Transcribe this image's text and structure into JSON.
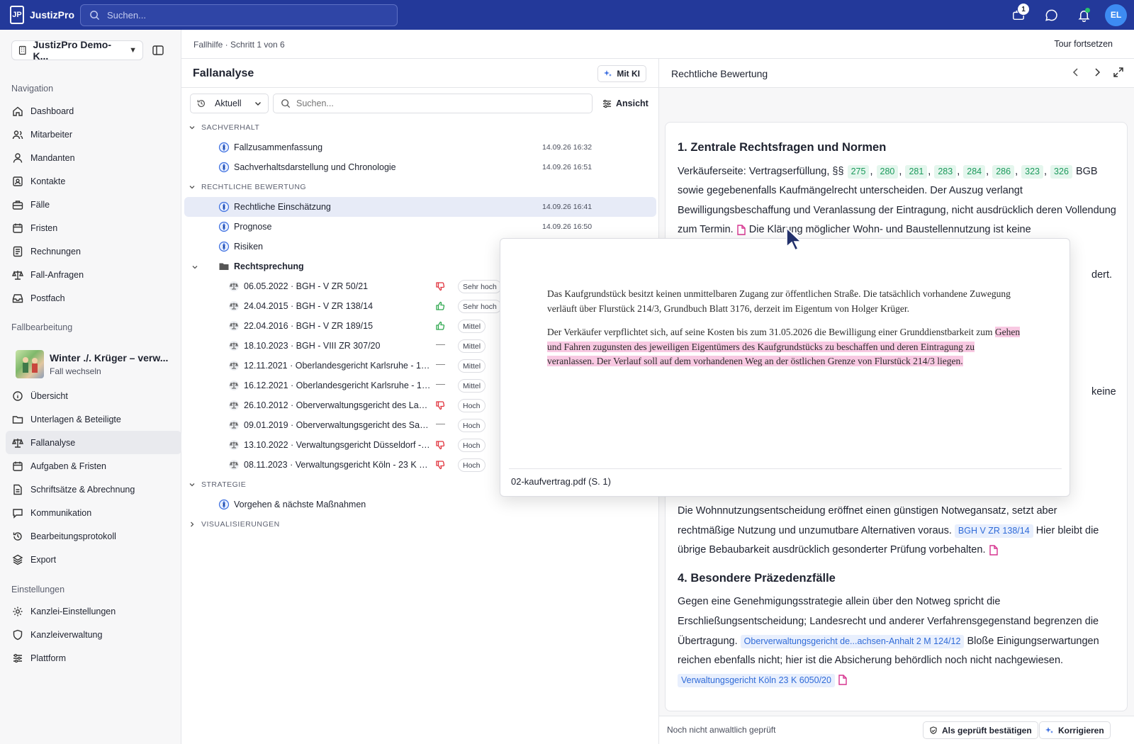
{
  "app": {
    "name": "JustizPro",
    "logo_text": "JP"
  },
  "topbar": {
    "search_placeholder": "Suchen...",
    "notification_count": "1",
    "avatar_initials": "EL"
  },
  "sidebar": {
    "tenant": "JustizPro Demo-K...",
    "navigation_title": "Navigation",
    "navigation": [
      {
        "label": "Dashboard",
        "icon": "home-icon"
      },
      {
        "label": "Mitarbeiter",
        "icon": "users-icon"
      },
      {
        "label": "Mandanten",
        "icon": "user-icon"
      },
      {
        "label": "Kontakte",
        "icon": "contact-icon"
      },
      {
        "label": "Fälle",
        "icon": "briefcase-icon"
      },
      {
        "label": "Fristen",
        "icon": "calendar-icon"
      },
      {
        "label": "Rechnungen",
        "icon": "receipt-icon"
      },
      {
        "label": "Fall-Anfragen",
        "icon": "scale-icon"
      },
      {
        "label": "Postfach",
        "icon": "inbox-icon"
      }
    ],
    "case_title": "Fallbearbeitung",
    "current_case": {
      "title": "Winter ./. Krüger – verw...",
      "action": "Fall wechseln"
    },
    "case_nav": [
      {
        "label": "Übersicht",
        "icon": "info-icon"
      },
      {
        "label": "Unterlagen & Beteiligte",
        "icon": "folder-icon"
      },
      {
        "label": "Fallanalyse",
        "icon": "scale-icon",
        "active": true
      },
      {
        "label": "Aufgaben & Fristen",
        "icon": "calendar-icon"
      },
      {
        "label": "Schriftsätze & Abrechnung",
        "icon": "document-icon"
      },
      {
        "label": "Kommunikation",
        "icon": "chat-icon"
      },
      {
        "label": "Bearbeitungsprotokoll",
        "icon": "history-icon"
      },
      {
        "label": "Export",
        "icon": "export-icon"
      }
    ],
    "settings_title": "Einstellungen",
    "settings": [
      {
        "label": "Kanzlei-Einstellungen",
        "icon": "gear-icon"
      },
      {
        "label": "Kanzleiverwaltung",
        "icon": "shield-icon"
      },
      {
        "label": "Plattform",
        "icon": "sliders-icon"
      }
    ]
  },
  "breadcrumb": {
    "text": "Fallhilfe · Schritt 1 von 6",
    "tour": "Tour fortsetzen"
  },
  "analysis": {
    "title": "Fallanalyse",
    "ai_button": "Mit KI",
    "filter": "Aktuell",
    "search_placeholder": "Suchen...",
    "view_button": "Ansicht",
    "groups": {
      "sachverhalt": "SACHVERHALT",
      "rechtlich": "RECHTLICHE BEWERTUNG",
      "strategie": "STRATEGIE",
      "visual": "VISUALISIERUNGEN"
    },
    "sachverhalt_items": [
      {
        "label": "Fallzusammenfassung",
        "date": "14.09.26 16:32"
      },
      {
        "label": "Sachverhaltsdarstellung und Chronologie",
        "date": "14.09.26 16:51"
      }
    ],
    "rechtlich_items": [
      {
        "label": "Rechtliche Einschätzung",
        "date": "14.09.26 16:41"
      },
      {
        "label": "Prognose",
        "date": "14.09.26 16:50"
      },
      {
        "label": "Risiken",
        "date": ""
      }
    ],
    "folder": "Rechtsprechung",
    "cases": [
      {
        "label": "06.05.2022 · BGH - V ZR 50/21",
        "verdict": "negative",
        "relevance": "Sehr hoch"
      },
      {
        "label": "24.04.2015 · BGH - V ZR 138/14",
        "verdict": "positive",
        "relevance": "Sehr hoch"
      },
      {
        "label": "22.04.2016 · BGH - V ZR 189/15",
        "verdict": "positive",
        "relevance": "Mittel"
      },
      {
        "label": "18.10.2023 · BGH - VIII ZR 307/20",
        "verdict": "neutral",
        "relevance": "Mittel"
      },
      {
        "label": "12.11.2021 · Oberlandesgericht Karlsruhe - 12 U 1...",
        "verdict": "neutral",
        "relevance": "Mittel"
      },
      {
        "label": "16.12.2021 · Oberlandesgericht Karlsruhe - 12 U ...",
        "verdict": "neutral",
        "relevance": "Mittel"
      },
      {
        "label": "26.10.2012 · Oberverwaltungsgericht des Lande...",
        "verdict": "negative",
        "relevance": "Hoch"
      },
      {
        "label": "09.01.2019 · Oberverwaltungsgericht des Saarla...",
        "verdict": "neutral",
        "relevance": "Hoch"
      },
      {
        "label": "13.10.2022 · Verwaltungsgericht Düsseldorf - 2...",
        "verdict": "negative",
        "relevance": "Hoch"
      },
      {
        "label": "08.11.2023 · Verwaltungsgericht Köln - 23 K 60...",
        "verdict": "negative",
        "relevance": "Hoch"
      }
    ],
    "strategie_items": [
      {
        "label": "Vorgehen & nächste Maßnahmen"
      }
    ]
  },
  "document": {
    "title": "Rechtliche Bewertung",
    "h1": "1. Zentrale Rechtsfragen und Normen",
    "p1_a": "Verkäuferseite: Vertragserfüllung, §§",
    "norms": [
      "275",
      "280",
      "281",
      "283",
      "284",
      "286",
      "323",
      "326"
    ],
    "p1_b": "BGB sowie gegebenenfalls Kaufmängelrecht unterscheiden. Der Auszug verlangt Bewilligungsbeschaffung und Veranlassung der Eintragung, nicht ausdrücklich deren Vollendung zum Termin.",
    "p1_c": "Die Klärung möglicher Wohn- und Baustellennutzung ist keine",
    "frag_a": "dert.",
    "frag_b": "keine",
    "p3_a": "Die Wohnnutzungsentscheidung eröffnet einen günstigen Notwegansatz, setzt aber rechtmäßige Nutzung und unzumutbare Alternativen voraus.",
    "cite1": "BGH V ZR 138/14",
    "p3_b": "Hier bleibt die übrige Bebaubarkeit ausdrücklich gesonderter Prüfung vorbehalten.",
    "h4": "4. Besondere Präzedenzfälle",
    "p4_a": "Gegen eine Genehmigungsstrategie allein über den Notweg spricht die Erschließungsentscheidung; Landesrecht und anderer Verfahrensgegenstand begrenzen die Übertragung.",
    "cite2": "Oberverwaltungsgericht de...achsen-Anhalt 2 M 124/12",
    "p4_b": "Bloße Einigungserwartungen reichen ebenfalls nicht; hier ist die Absicherung behördlich noch nicht nachgewiesen.",
    "cite3": "Verwaltungsgericht Köln 23 K 6050/20",
    "status": "Noch nicht anwaltlich geprüft",
    "confirm_button": "Als geprüft bestätigen",
    "correct_button": "Korrigieren"
  },
  "popover": {
    "para1": "Das Kaufgrundstück besitzt keinen unmittelbaren Zugang zur öffentlichen Straße. Die tatsächlich vorhandene Zuwegung verläuft über Flurstück 214/3, Grundbuch Blatt 3176, derzeit im Eigentum von Holger Krüger.",
    "para2_a": "Der Verkäufer verpflichtet sich, auf seine Kosten bis zum 31.05.2026 die Bewilligung einer Grunddienstbarkeit zum",
    "para2_hl": "Gehen und Fahren zugunsten des jeweiligen Eigentümers des Kaufgrundstücks zu beschaffen und deren Eintragung zu veranlassen. Der Verlauf soll auf dem vorhandenen Weg an der östlichen Grenze von Flurstück 214/3 liegen.",
    "file": "02-kaufvertrag.pdf (S. 1)"
  },
  "colors": {
    "topbar": "#23399a",
    "accent": "#3d8bf2",
    "norm_green": "#1c9a5c",
    "cite_blue": "#2f6bd8",
    "negative": "#e0323c",
    "positive": "#2fa84f",
    "highlight": "#f8c9e2"
  }
}
